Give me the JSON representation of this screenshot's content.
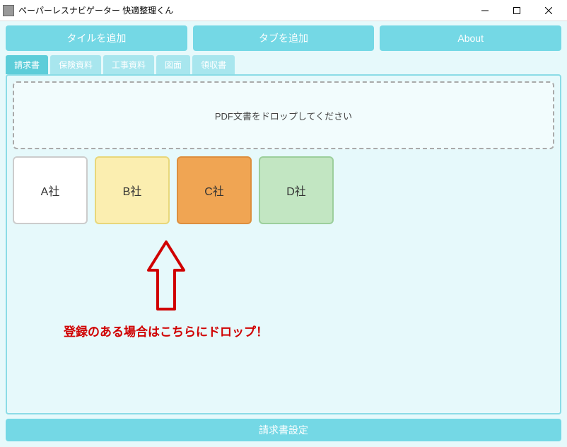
{
  "window": {
    "title": "ペーパーレスナビゲーター 快適整理くん"
  },
  "toolbar": {
    "add_tile": "タイルを追加",
    "add_tab": "タブを追加",
    "about": "About"
  },
  "tabs": [
    {
      "label": "請求書",
      "active": true
    },
    {
      "label": "保険資料",
      "active": false
    },
    {
      "label": "工事資料",
      "active": false
    },
    {
      "label": "図面",
      "active": false
    },
    {
      "label": "領収書",
      "active": false
    }
  ],
  "dropzone": {
    "hint": "PDF文書をドロップしてください"
  },
  "tiles": [
    {
      "label": "A社",
      "style": "a"
    },
    {
      "label": "B社",
      "style": "b"
    },
    {
      "label": "C社",
      "style": "c"
    },
    {
      "label": "D社",
      "style": "d"
    }
  ],
  "annotation": {
    "text": "登録のある場合はこちらにドロップ！"
  },
  "footer": {
    "settings": "請求書設定"
  }
}
